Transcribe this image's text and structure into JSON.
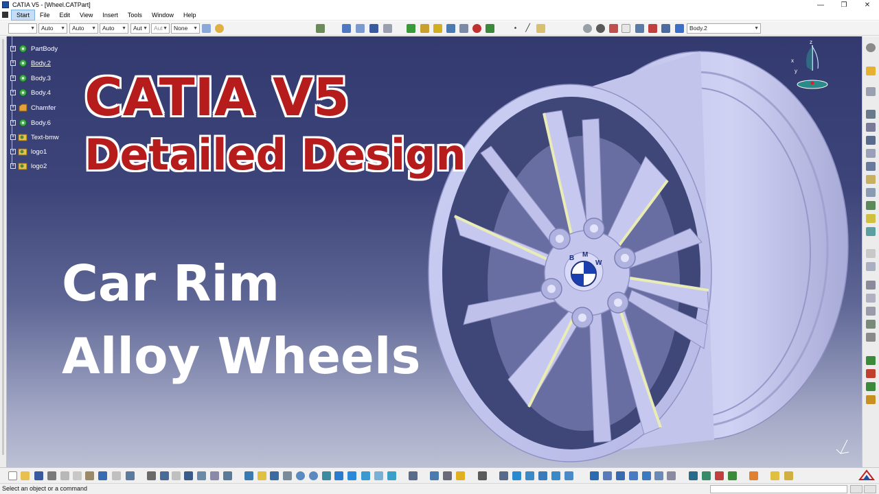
{
  "window": {
    "title": "CATIA V5 - [Wheel.CATPart]",
    "controls": [
      "—",
      "❐",
      "✕"
    ]
  },
  "menu": {
    "items": [
      "Start",
      "File",
      "Edit",
      "View",
      "Insert",
      "Tools",
      "Window",
      "Help"
    ]
  },
  "toolbar": {
    "color_combo": "",
    "combo_1": "Auto",
    "combo_2": "Auto",
    "combo_3": "Auto",
    "combo_4": "Aut",
    "combo_5": "Aut",
    "combo_6": "None",
    "current_body": "Body.2"
  },
  "tree": {
    "items": [
      {
        "label": "PartBody",
        "underlined": false
      },
      {
        "label": "Body.2",
        "underlined": true
      },
      {
        "label": "Body.3",
        "underlined": false
      },
      {
        "label": "Body.4",
        "underlined": false
      },
      {
        "label": "Chamfer",
        "underlined": false
      },
      {
        "label": "Body.6",
        "underlined": false
      },
      {
        "label": "Text-bmw",
        "underlined": false
      },
      {
        "label": "logo1",
        "underlined": false
      },
      {
        "label": "logo2",
        "underlined": false
      }
    ]
  },
  "overlay": {
    "line1": "CATIA V5",
    "line2": "Detailed Design",
    "line3": "Car Rim",
    "line4": "Alloy Wheels"
  },
  "model": {
    "emblem_text": [
      "B",
      "M",
      "W"
    ],
    "rim_color": "#c6c8ee",
    "chamfer_color": "#e9ecb4"
  },
  "compass": {
    "x": "x",
    "y": "y",
    "z": "z"
  },
  "status": {
    "message": "Select an object or a command"
  }
}
